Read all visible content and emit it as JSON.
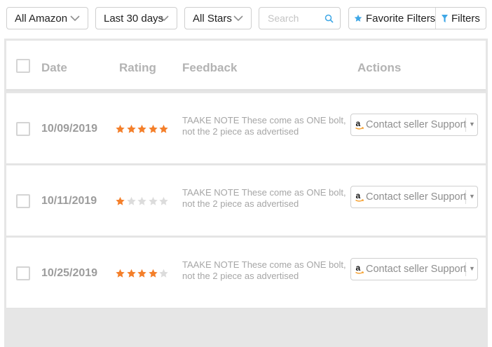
{
  "toolbar": {
    "marketplace_dropdown": "All Amazon",
    "date_range_dropdown": "Last 30 days",
    "stars_dropdown": "All Stars",
    "search": {
      "value": "",
      "placeholder": "Search"
    },
    "favorite_filters_label": "Favorite Filters",
    "filters_label": "Filters"
  },
  "colors": {
    "star_filled": "#f47f2a",
    "star_empty": "#dcdcdc",
    "accent_blue": "#3fa7e6"
  },
  "table": {
    "columns": {
      "date": "Date",
      "rating": "Rating",
      "feedback": "Feedback",
      "actions": "Actions"
    },
    "rows": [
      {
        "date": "10/09/2019",
        "rating": 5,
        "feedback": "TAAKE NOTE These come as ONE bolt, not the 2 piece as advertised",
        "action_label": "Contact seller Support"
      },
      {
        "date": "10/11/2019",
        "rating": 1,
        "feedback": "TAAKE NOTE These come as ONE bolt, not the 2 piece as advertised",
        "action_label": "Contact seller Support"
      },
      {
        "date": "10/25/2019",
        "rating": 4,
        "feedback": "TAAKE NOTE These come as ONE bolt, not the 2 piece as advertised",
        "action_label": "Contact seller Support"
      }
    ]
  },
  "icons": {
    "dropdown": "chevron-down-icon",
    "search": "search-icon",
    "favorite": "star-icon",
    "filter": "filter-funnel-icon",
    "action_logo": "amazon-logo-icon",
    "action_menu": "caret-down-icon"
  }
}
